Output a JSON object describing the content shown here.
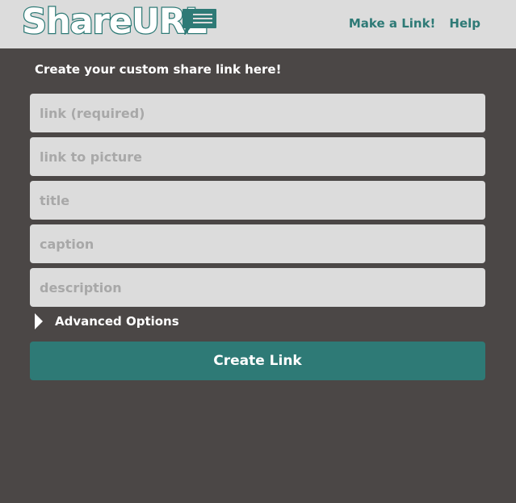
{
  "header": {
    "logo_text": "ShareURL",
    "nav": [
      {
        "label": "Make a Link!"
      },
      {
        "label": "Help"
      }
    ]
  },
  "form": {
    "intro": "Create your custom share link here!",
    "fields": [
      {
        "placeholder": "link (required)",
        "value": ""
      },
      {
        "placeholder": "link to picture",
        "value": ""
      },
      {
        "placeholder": "title",
        "value": ""
      },
      {
        "placeholder": "caption",
        "value": ""
      },
      {
        "placeholder": "description",
        "value": ""
      }
    ],
    "advanced_label": "Advanced Options",
    "submit_label": "Create Link"
  },
  "colors": {
    "brand": "#2e7a76",
    "background": "#4b4746",
    "header": "#dcdcdc",
    "field": "#dcdcdc"
  },
  "icons": [
    "speech-bubble-icon",
    "expand-triangle-icon"
  ]
}
